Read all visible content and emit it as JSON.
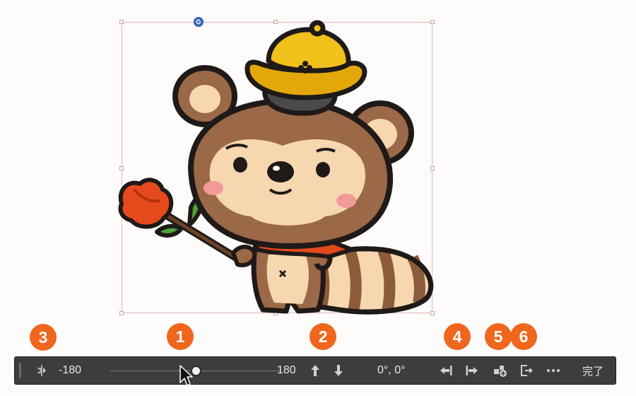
{
  "badges": {
    "b1": "1",
    "b2": "2",
    "b3": "3",
    "b4": "4",
    "b5": "5",
    "b6": "6"
  },
  "toolbar": {
    "min_label": "-180",
    "max_label": "180",
    "rotation_readout": "0°, 0°",
    "done_label": "完了",
    "slider_value": 0
  },
  "icons": {
    "flip": "flip-horizontal-icon",
    "up": "arrow-up-icon",
    "down": "arrow-down-icon",
    "move_left": "align-left-icon",
    "move_right": "align-right-icon",
    "add_layer": "add-to-layer-icon",
    "export": "export-icon",
    "more": "more-icon"
  },
  "colors": {
    "badge": "#f0661c",
    "toolbar_bg": "#3d3d3d",
    "selection": "#e2b5b5"
  }
}
